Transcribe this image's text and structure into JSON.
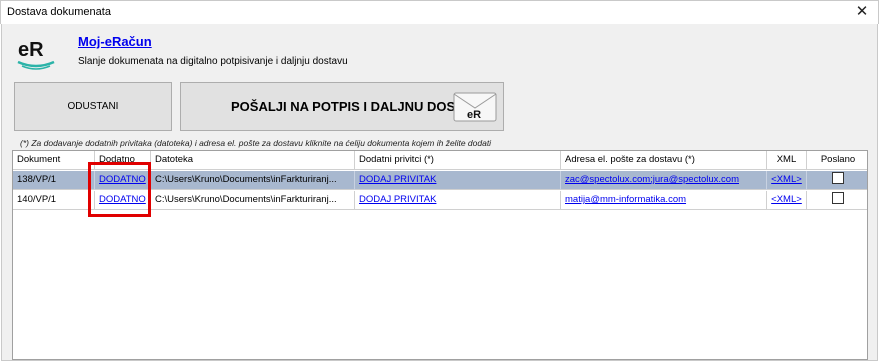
{
  "window": {
    "title": "Dostava dokumenata",
    "close_glyph": "✕"
  },
  "header": {
    "logo_text": "eR",
    "app_link": "Moj-eRačun",
    "subtitle": "Slanje dokumenata na digitalno potpisivanje i daljnju dostavu"
  },
  "buttons": {
    "cancel": "ODUSTANI",
    "send": "POŠALJI NA POTPIS I DALJNU DOSTAVU",
    "send_icon_text": "eR"
  },
  "hint": "(*) Za dodavanje dodatnih privitaka (datoteka) i adresa el. pošte za dostavu kliknite na ćeliju dokumenta kojem ih želite dodati",
  "table": {
    "columns": [
      "Dokument",
      "Dodatno",
      "Datoteka",
      "Dodatni privitci (*)",
      "Adresa el. pošte za dostavu (*)",
      "XML",
      "Poslano"
    ],
    "rows": [
      {
        "document": "138/VP/1",
        "extra": "DODATNO",
        "file": "C:\\Users\\Kruno\\Documents\\inFarkturiranj...",
        "attachment": "DODAJ PRIVITAK",
        "email": "zac@spectolux.com;jura@spectolux.com",
        "xml": "<XML>",
        "sent": false,
        "selected": true
      },
      {
        "document": "140/VP/1",
        "extra": "DODATNO",
        "file": "C:\\Users\\Kruno\\Documents\\inFarkturiranj...",
        "attachment": "DODAJ PRIVITAK",
        "email": "matija@mm-informatika.com",
        "xml": "<XML>",
        "sent": false,
        "selected": false
      }
    ]
  },
  "colors": {
    "selection": "#a8b8cf",
    "link": "#0000ee",
    "highlight": "#e00000",
    "logo_teal": "#2bb3a8"
  },
  "icons": {
    "close": "close-icon",
    "logo": "eracun-logo-icon",
    "envelope": "envelope-icon"
  }
}
